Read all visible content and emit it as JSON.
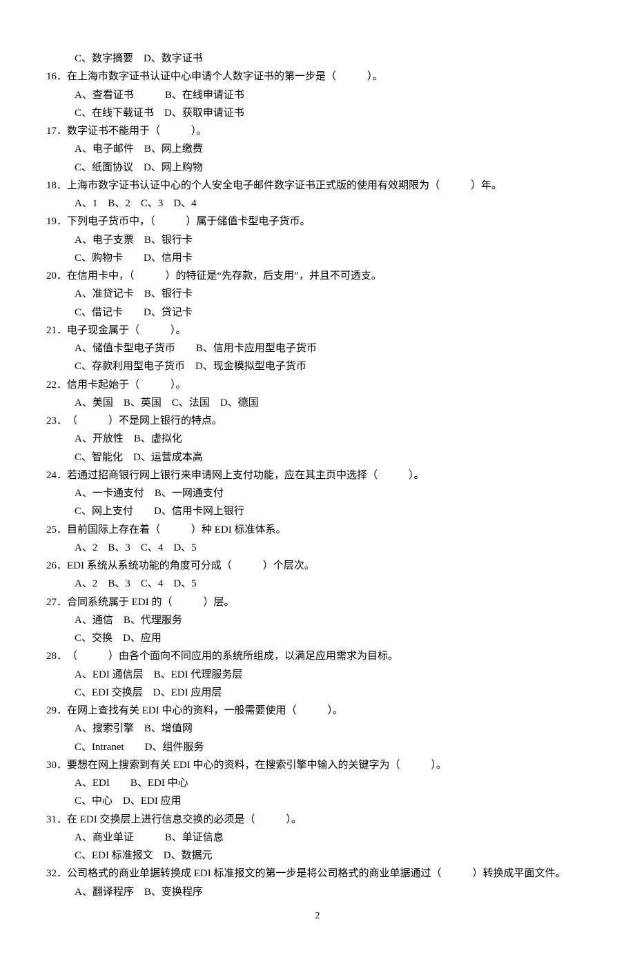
{
  "page_number": "2",
  "orphan_options": "C、数字摘要　D、数字证书",
  "questions": [
    {
      "num": "16．",
      "text": "在上海市数字证书认证中心申请个人数字证书的第一步是（　　　）。",
      "opts": [
        "A、查看证书　　　B、在线申请证书",
        "C、在线下载证书　D、获取申请证书"
      ]
    },
    {
      "num": "17．",
      "text": "数字证书不能用于（　　　）。",
      "opts": [
        "A、电子邮件　B、网上缴费",
        "C、纸面协议　D、网上购物"
      ]
    },
    {
      "num": "18．",
      "text": "上海市数字证书认证中心的个人安全电子邮件数字证书正式版的使用有效期限为（　　　）年。",
      "opts": [
        "A、1　B、2　C、3　D、4"
      ]
    },
    {
      "num": "19．",
      "text": "下列电子货币中，（　　　）属于储值卡型电子货币。",
      "opts": [
        "A、电子支票　B、银行卡",
        "C、购物卡　　D、信用卡"
      ]
    },
    {
      "num": "20．",
      "text": "在信用卡中，（　　　）的特征是“先存款，后支用”，并且不可透支。",
      "opts": [
        "A、准贷记卡　B、银行卡",
        "C、借记卡　　D、贷记卡"
      ]
    },
    {
      "num": "21．",
      "text": "电子现金属于（　　　）。",
      "opts": [
        "A、储值卡型电子货币　　B、信用卡应用型电子货币",
        "C、存款利用型电子货币　D、现金模拟型电子货币"
      ]
    },
    {
      "num": "22．",
      "text": "信用卡起始于（　　　）。",
      "opts": [
        "A、美国　B、英国　C、法国　D、德国"
      ]
    },
    {
      "num": "23．",
      "text": "（　　　）不是网上银行的特点。",
      "opts": [
        "A、开放性　B、虚拟化",
        "C、智能化　D、运营成本高"
      ]
    },
    {
      "num": "24．",
      "text": "若通过招商银行网上银行来申请网上支付功能，应在其主页中选择（　　　）。",
      "opts": [
        "A、一卡通支付　B、一网通支付",
        "C、网上支付　　D、信用卡网上银行"
      ]
    },
    {
      "num": "25．",
      "text": "目前国际上存在着（　　　）种 EDI 标准体系。",
      "opts": [
        "A、2　B、3　C、4　D、5"
      ]
    },
    {
      "num": "26．",
      "text": "EDI 系统从系统功能的角度可分成（　　　）个层次。",
      "opts": [
        "A、2　B、3　C、4　D、5"
      ]
    },
    {
      "num": "27．",
      "text": "合同系统属于 EDI 的（　　　）层。",
      "opts": [
        "A、通信　B、代理服务",
        "C、交换　D、应用"
      ]
    },
    {
      "num": "28．",
      "text": "（　　　）由各个面向不同应用的系统所组成，以满足应用需求为目标。",
      "opts": [
        "A、EDI 通信层　B、EDI 代理服务层",
        "C、EDI 交换层　D、EDI 应用层"
      ]
    },
    {
      "num": "29．",
      "text": "在网上查找有关 EDI 中心的资料，一般需要使用（　　　）。",
      "opts": [
        "A、搜索引擎　B、增值网",
        "C、Intranet　　D、组件服务"
      ]
    },
    {
      "num": "30．",
      "text": "要想在网上搜索到有关 EDI 中心的资料，在搜索引擎中输入的关键字为（　　　）。",
      "opts": [
        "A、EDI　　B、EDI 中心",
        "C、中心　D、EDI 应用"
      ]
    },
    {
      "num": "31．",
      "text": "在 EDI 交换层上进行信息交换的必须是（　　　）。",
      "opts": [
        "A、商业单证　　　B、单证信息",
        "C、EDI 标准报文　D、数据元"
      ]
    },
    {
      "num": "32．",
      "text": "公司格式的商业单据转换成 EDI 标准报文的第一步是将公司格式的商业单据通过（　　　）转换成平面文件。",
      "opts": [
        "A、翻译程序　B、变换程序"
      ]
    }
  ]
}
